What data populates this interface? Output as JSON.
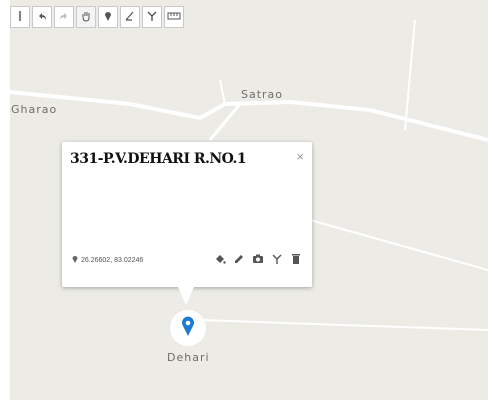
{
  "map": {
    "places": [
      {
        "id": "gharao",
        "label": "Gharao"
      },
      {
        "id": "satrao",
        "label": "Satrao"
      },
      {
        "id": "dehari",
        "label": "Dehari"
      }
    ]
  },
  "toolbar": {
    "tools": [
      "pan-left",
      "undo",
      "redo",
      "hand-pan",
      "add-marker",
      "draw-line",
      "add-route",
      "measure"
    ]
  },
  "popup": {
    "title": "331-P.V.DEHARI R.NO.1",
    "close_label": "×",
    "coordinates": "26.26602, 83.02246",
    "actions": [
      "fill-color",
      "edit",
      "camera",
      "route",
      "delete"
    ]
  },
  "colors": {
    "map_bg": "#ecebe6",
    "road": "#ffffff",
    "marker": "#1f7bd1",
    "toolbar_border": "#c9c9c9"
  }
}
